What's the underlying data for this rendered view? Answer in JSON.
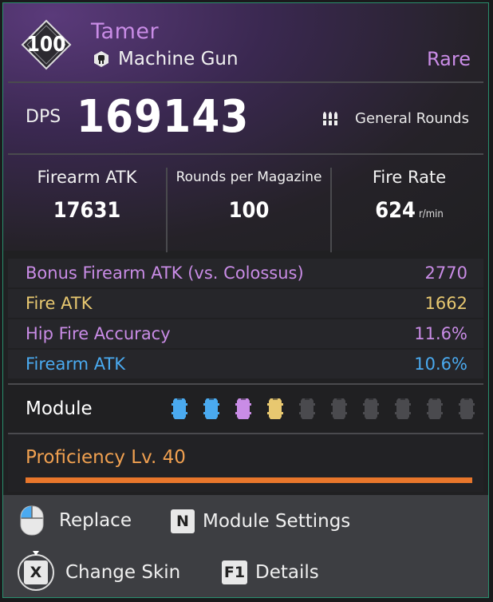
{
  "weapon": {
    "level": "100",
    "name": "Tamer",
    "type": "Machine Gun",
    "rarity": "Rare",
    "rarity_color": "#c98ce6"
  },
  "dps": {
    "label": "DPS",
    "value": "169143",
    "ammo_type": "General Rounds",
    "ammo_icon": "bullets-icon"
  },
  "stats": [
    {
      "label": "Firearm ATK",
      "value": "17631",
      "unit": ""
    },
    {
      "label": "Rounds per Magazine",
      "value": "100",
      "unit": ""
    },
    {
      "label": "Fire Rate",
      "value": "624",
      "unit": "r/min"
    }
  ],
  "bonuses": [
    {
      "label": "Bonus Firearm ATK (vs. Colossus)",
      "value": "2770",
      "color": "#c98ce6"
    },
    {
      "label": "Fire ATK",
      "value": "1662",
      "color": "#e8c870"
    },
    {
      "label": "Hip Fire Accuracy",
      "value": "11.6%",
      "color": "#c98ce6"
    },
    {
      "label": "Firearm ATK",
      "value": "10.6%",
      "color": "#4aaaf0"
    }
  ],
  "module": {
    "label": "Module",
    "slots": [
      "#4aaaf0",
      "#4aaaf0",
      "#c98ce6",
      "#e8c870",
      "#4a4a4e",
      "#4a4a4e",
      "#4a4a4e",
      "#4a4a4e",
      "#4a4a4e",
      "#4a4a4e"
    ]
  },
  "proficiency": {
    "label": "Proficiency Lv. 40",
    "progress": 1.0,
    "color": "#e8762b"
  },
  "footer": {
    "replace": "Replace",
    "module_settings_key": "N",
    "module_settings": "Module Settings",
    "change_skin_key": "X",
    "change_skin": "Change Skin",
    "details_key": "F1",
    "details": "Details"
  }
}
